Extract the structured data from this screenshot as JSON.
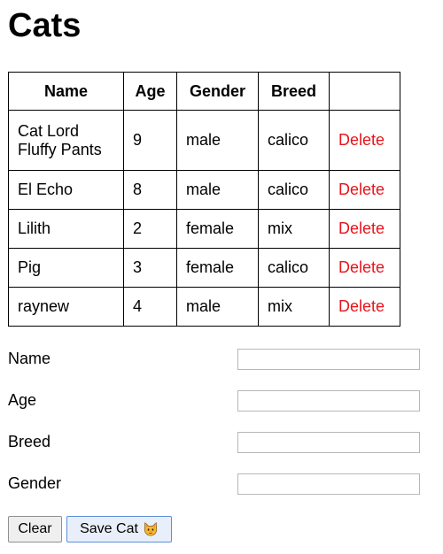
{
  "page": {
    "title": "Cats"
  },
  "table": {
    "headers": [
      "Name",
      "Age",
      "Gender",
      "Breed",
      ""
    ],
    "delete_label": "Delete",
    "rows": [
      {
        "name": "Cat Lord Fluffy Pants",
        "age": "9",
        "gender": "male",
        "breed": "calico"
      },
      {
        "name": "El Echo",
        "age": "8",
        "gender": "male",
        "breed": "calico"
      },
      {
        "name": "Lilith",
        "age": "2",
        "gender": "female",
        "breed": "mix"
      },
      {
        "name": "Pig",
        "age": "3",
        "gender": "female",
        "breed": "calico"
      },
      {
        "name": "raynew",
        "age": "4",
        "gender": "male",
        "breed": "mix"
      }
    ]
  },
  "form": {
    "name_label": "Name",
    "name_value": "",
    "age_label": "Age",
    "age_value": "",
    "breed_label": "Breed",
    "breed_value": "",
    "gender_label": "Gender",
    "gender_value": ""
  },
  "buttons": {
    "clear_label": "Clear",
    "save_label": "Save Cat",
    "save_icon": "cat-face-icon"
  },
  "colors": {
    "delete_link": "#e8131a",
    "save_button_border": "#5b8fd8",
    "save_button_bg": "#e9effa",
    "cat_icon": "#f5b731"
  }
}
